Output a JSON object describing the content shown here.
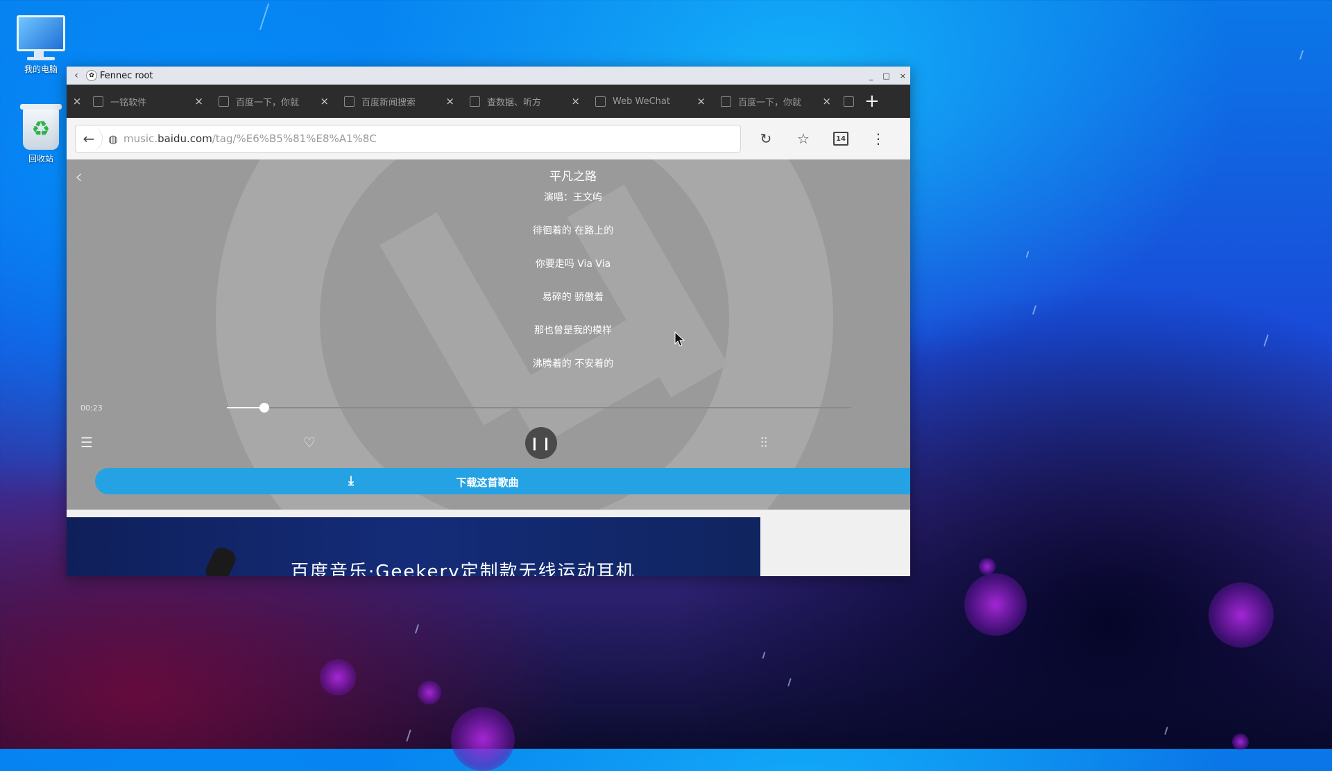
{
  "desktop": {
    "icons": [
      {
        "label": "我的电脑",
        "icon": "computer-icon"
      },
      {
        "label": "回收站",
        "icon": "recycle-bin-icon"
      }
    ]
  },
  "window": {
    "title": "Fennec root",
    "controls": {
      "minimize": "_",
      "maximize": "□",
      "close": "×"
    }
  },
  "tabs": [
    {
      "title": "一铭软件"
    },
    {
      "title": "百度一下，你就"
    },
    {
      "title": "百度新闻搜索"
    },
    {
      "title": "查数据、听方"
    },
    {
      "title": "Web WeChat"
    },
    {
      "title": "百度一下，你就"
    }
  ],
  "tab_close": "×",
  "new_tab": "+",
  "urlbar": {
    "scheme_prefix": "music.",
    "domain": "baidu.com",
    "path": "/tag/%E6%B5%81%E8%A1%8C",
    "tab_count": "14"
  },
  "player": {
    "song_title": "平凡之路",
    "artist": "演唱：王文屿",
    "lyrics": [
      "徘徊着的 在路上的",
      "你要走吗 Via Via",
      "易碎的 骄傲着",
      "那也曾是我的模样",
      "沸腾着的 不安着的"
    ],
    "elapsed": "00:23",
    "progress": 0.06,
    "download_label": "下载这首歌曲"
  },
  "banner": {
    "text": "百度音乐·Geekery定制款无线运动耳机"
  },
  "colors": {
    "accent": "#25a2e3",
    "player_bg": "#9a9a9a",
    "tabbar_bg": "#2c2c2c"
  }
}
